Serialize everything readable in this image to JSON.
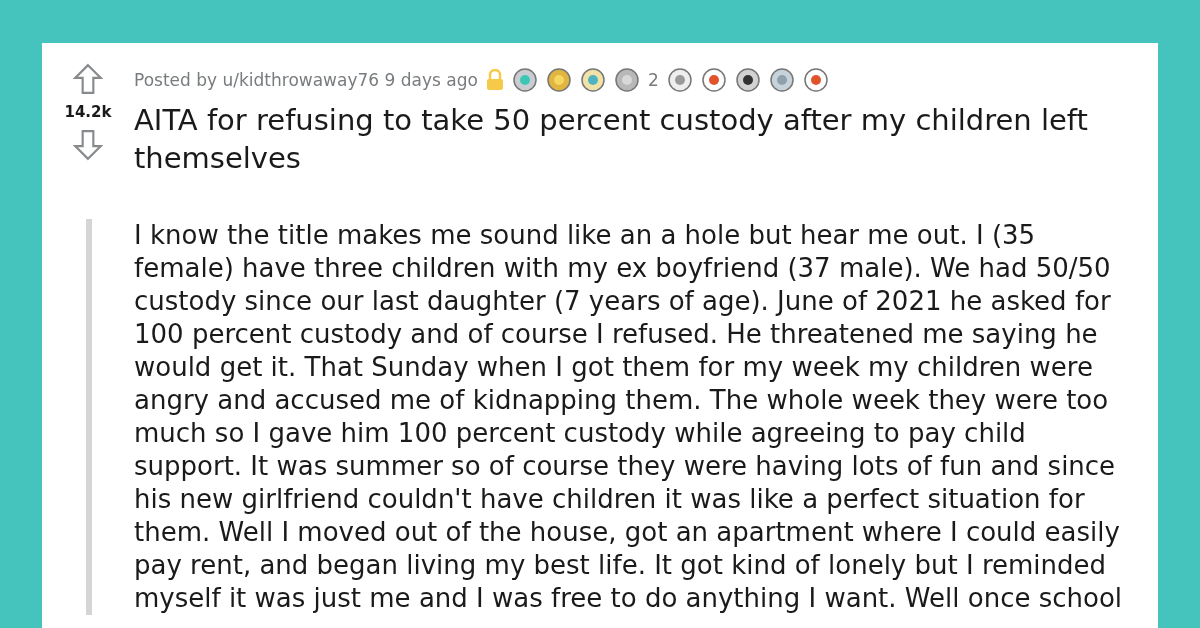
{
  "post": {
    "score": "14.2k",
    "posted_by": "Posted by u/kidthrowaway76 9 days ago",
    "locked": true,
    "awards": [
      {
        "kind": "badge"
      },
      {
        "kind": "star"
      },
      {
        "kind": "seal"
      },
      {
        "kind": "handshake",
        "count": "2"
      },
      {
        "kind": "face"
      },
      {
        "kind": "mascot"
      },
      {
        "kind": "coin"
      },
      {
        "kind": "cat"
      },
      {
        "kind": "alien"
      }
    ],
    "title": "AITA for refusing to take 50 percent custody after my children left themselves",
    "body": "I know the title makes me sound like an a hole but hear me out. I (35 female) have three children with my ex boyfriend (37 male). We had 50/50 custody since our last daughter (7 years of age). June of 2021 he asked for 100 percent custody and of course I refused. He threatened me saying he would get it. That Sunday when I got them for my week my children were angry and accused me of kidnapping them. The whole week they were too much so I gave him 100 percent custody while agreeing to pay child support. It was summer so of course they were having lots of fun and since his new girlfriend couldn't have children it was like a perfect situation for them. Well I moved out of the house, got an apartment where I could easily pay rent, and began living my best life. It got kind of lonely but I reminded myself it was just me and I was free to do anything I want. Well once school"
  }
}
